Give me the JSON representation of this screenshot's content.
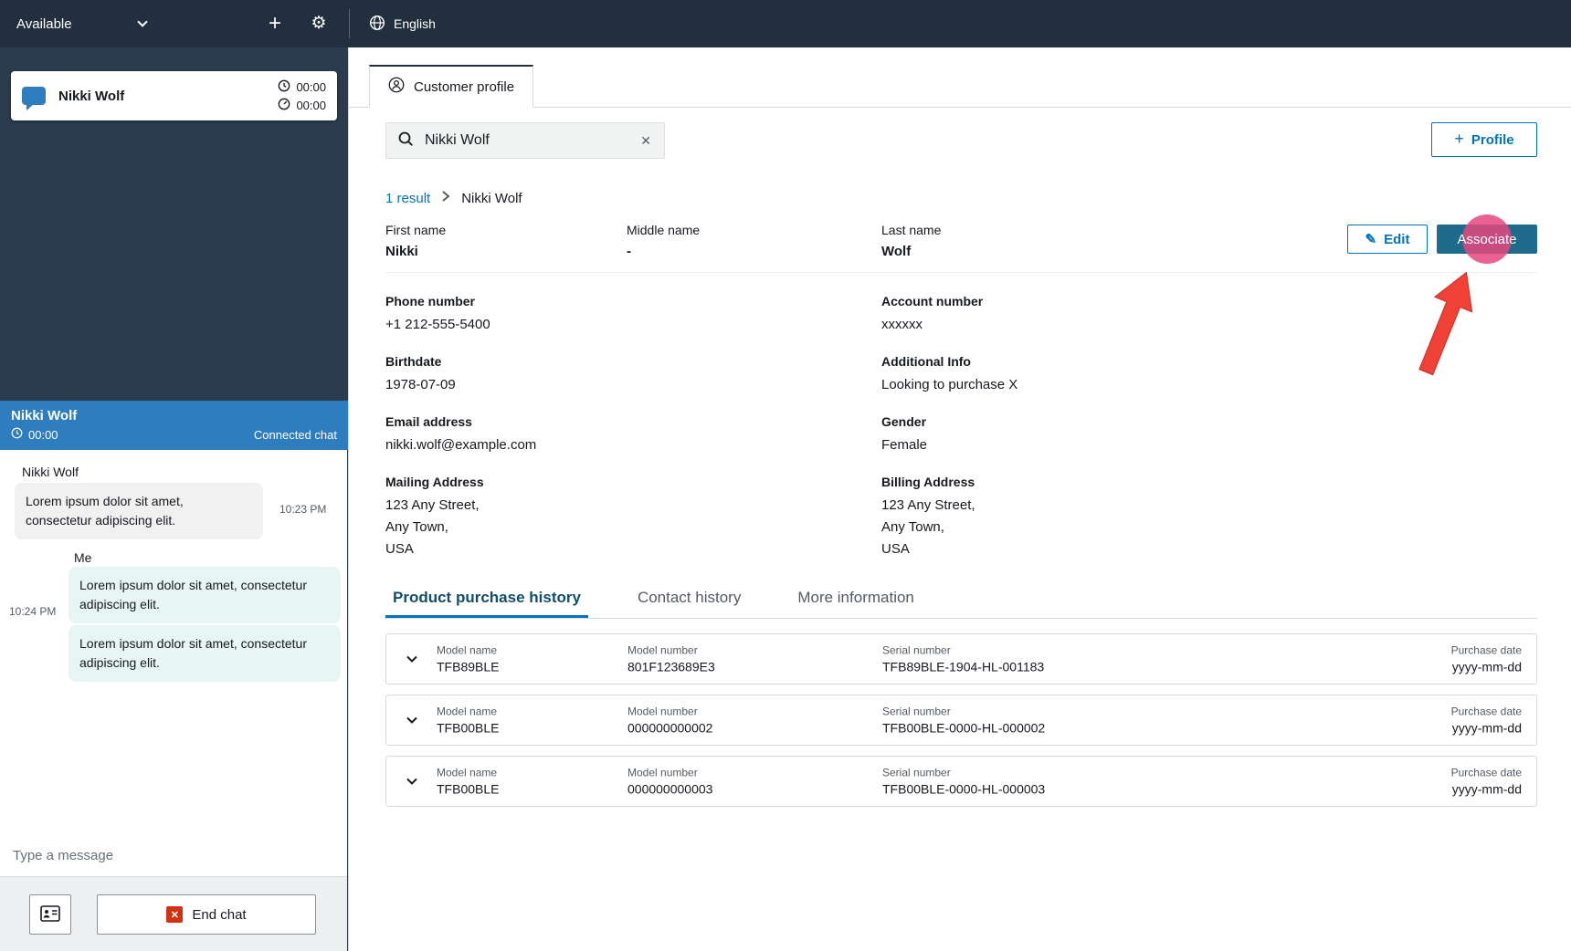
{
  "colors": {
    "topbar_bg": "#232f3e",
    "sidebar_bg": "#2b3c4e",
    "chat_header_bg": "#2e7dbe",
    "accent_blue": "#0073bb",
    "associate_bg": "#1f6b8c",
    "agent_bubble": "#e8f5f5",
    "customer_bubble": "#f1f1f1",
    "end_chat_red": "#d13212",
    "highlight_pink": "#e5477e",
    "arrow_red": "#ef4136"
  },
  "icons": {
    "plus": "+",
    "gear": "⚙",
    "clear": "✕",
    "pencil": "✎",
    "end_chat_x": "✕"
  },
  "topbar": {
    "status": "Available",
    "language": "English"
  },
  "sidebar": {
    "contact_card": {
      "name": "Nikki Wolf",
      "chat_timer": "00:00",
      "acw_timer": "00:00"
    },
    "chat": {
      "header": {
        "name": "Nikki Wolf",
        "timer": "00:00",
        "status": "Connected chat"
      },
      "customer": {
        "sender": "Nikki Wolf",
        "text": "Lorem ipsum dolor sit amet, consectetur adipiscing elit.",
        "time": "10:23 PM"
      },
      "agent": {
        "sender": "Me",
        "time": "10:24 PM",
        "bubbles": [
          "Lorem ipsum dolor sit amet, consectetur adipiscing elit.",
          "Lorem ipsum dolor sit amet, consectetur adipiscing elit."
        ]
      },
      "input_placeholder": "Type a message",
      "end_chat_label": "End chat"
    }
  },
  "main": {
    "tab_label": "Customer profile",
    "search": {
      "value": "Nikki Wolf"
    },
    "profile_button_label": "Profile",
    "breadcrumb": {
      "results": "1 result",
      "current": "Nikki Wolf"
    },
    "name_fields": {
      "first": {
        "label": "First name",
        "value": "Nikki"
      },
      "middle": {
        "label": "Middle name",
        "value": "-"
      },
      "last": {
        "label": "Last name",
        "value": "Wolf"
      }
    },
    "actions": {
      "edit": "Edit",
      "associate": "Associate"
    },
    "details": {
      "left": [
        {
          "label": "Phone number",
          "value": "+1 212-555-5400"
        },
        {
          "label": "Birthdate",
          "value": "1978-07-09"
        },
        {
          "label": "Email address",
          "value": "nikki.wolf@example.com"
        },
        {
          "label": "Mailing Address",
          "value": "123 Any Street,\nAny Town,\nUSA"
        }
      ],
      "right": [
        {
          "label": "Account number",
          "value": "xxxxxx"
        },
        {
          "label": "Additional Info",
          "value": "Looking to purchase X"
        },
        {
          "label": "Gender",
          "value": "Female"
        },
        {
          "label": "Billing Address",
          "value": "123 Any Street,\nAny Town,\nUSA"
        }
      ]
    },
    "tabs": [
      {
        "label": "Product purchase history",
        "active": true
      },
      {
        "label": "Contact history",
        "active": false
      },
      {
        "label": "More information",
        "active": false
      }
    ],
    "purchases": {
      "columns": {
        "model_name": "Model name",
        "model_number": "Model number",
        "serial_number": "Serial number",
        "purchase_date": "Purchase date"
      },
      "rows": [
        {
          "model_name": "TFB89BLE",
          "model_number": "801F123689E3",
          "serial_number": "TFB89BLE-1904-HL-001183",
          "purchase_date": "yyyy-mm-dd"
        },
        {
          "model_name": "TFB00BLE",
          "model_number": "000000000002",
          "serial_number": "TFB00BLE-0000-HL-000002",
          "purchase_date": "yyyy-mm-dd"
        },
        {
          "model_name": "TFB00BLE",
          "model_number": "000000000003",
          "serial_number": "TFB00BLE-0000-HL-000003",
          "purchase_date": "yyyy-mm-dd"
        }
      ]
    }
  }
}
